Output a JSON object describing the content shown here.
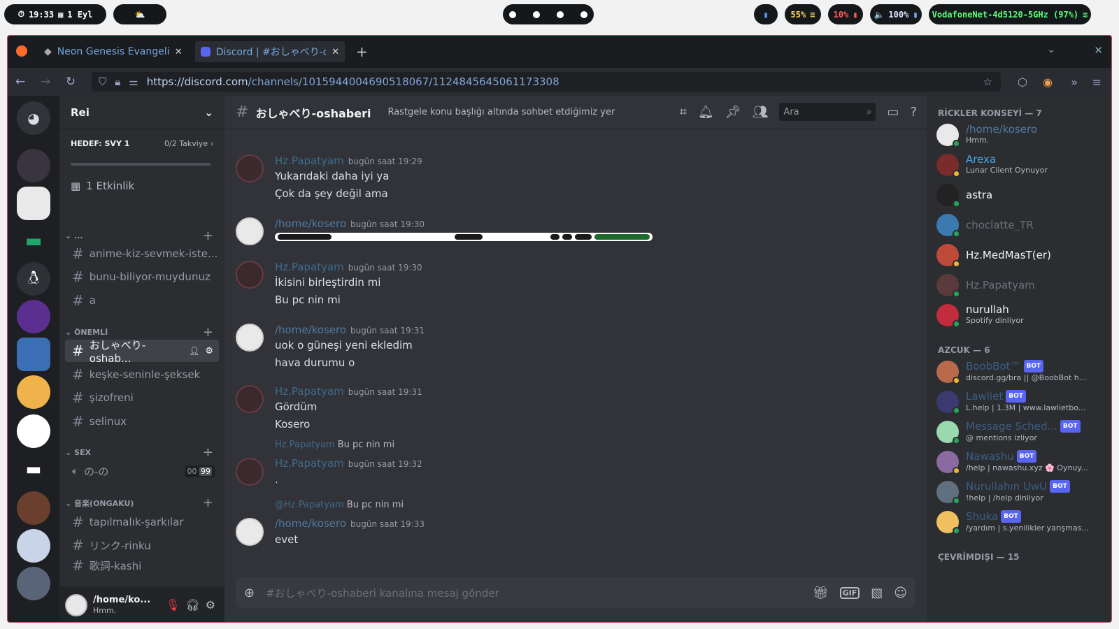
{
  "topbar": {
    "time": "19:33",
    "date": "1 Eyl",
    "brightness": "55%",
    "battery": "10%",
    "volume": "100%",
    "wifi": "VodafoneNet-4d5120-5GHz (97%)"
  },
  "browser": {
    "tabs": [
      {
        "label": "Neon Genesis Evangelion"
      },
      {
        "label": "Discord | #おしゃべり-os"
      }
    ],
    "url_domain": "https://discord.com",
    "url_path": "/channels/1015944004690518067/1124845645061173308"
  },
  "server": {
    "name": "Rei",
    "boost_goal": "HEDEF: SVY 1",
    "boost_count": "0/2 Takviye",
    "boost_progress": 0,
    "events": "1 Etkinlik",
    "categories": [
      {
        "name": "...",
        "channels": [
          "anime-kiz-sevmek-iste...",
          "bunu-biliyor-muydunuz",
          "a"
        ]
      },
      {
        "name": "ÖNEMLİ",
        "channels": [
          "おしゃべり-oshab...",
          "keşke-seninle-şeksek",
          "şizofreni",
          "selinux"
        ]
      },
      {
        "name": "SEX",
        "voice": "の-の",
        "voice_counts": [
          "00",
          "99"
        ]
      },
      {
        "name": "音楽(ONGAKU)",
        "channels": [
          "tapılmalık-şarkılar",
          "リンク-rinku",
          "歌詞-kashi"
        ]
      }
    ],
    "user": {
      "name": "/home/ko...",
      "status": "Hmm."
    }
  },
  "chat": {
    "channel": "おしゃべり-oshaberi",
    "topic": "Rastgele konu başlığı altında sohbet etdiğimiz yer",
    "search_placeholder": "Ara",
    "input_placeholder": "#おしゃべり-oshaberi kanalına mesaj gönder",
    "gif_label": "GIF",
    "messages": [
      {
        "author": "Hz.Papatyam",
        "time": "bugün saat 19:29",
        "lines": [
          "Yukarıdaki daha iyi ya",
          "Çok da şey değil ama"
        ]
      },
      {
        "author": "/home/kosero",
        "time": "bugün saat 19:30",
        "lines": []
      },
      {
        "author": "Hz.Papatyam",
        "time": "bugün saat 19:30",
        "lines": [
          "İkisini birleştirdin mi",
          "Bu pc nin mi"
        ]
      },
      {
        "author": "/home/kosero",
        "time": "bugün saat 19:31",
        "lines": [
          "uok o güneşi yeni ekledim",
          "hava durumu o"
        ]
      },
      {
        "author": "Hz.Papatyam",
        "time": "bugün saat 19:31",
        "lines": [
          "Gördüm",
          "Kosero"
        ]
      },
      {
        "author": "Hz.Papatyam",
        "time": "bugün saat 19:32",
        "lines": [
          "."
        ],
        "reply_to": "Hz.Papatyam",
        "reply_text": "Bu pc nin mi"
      },
      {
        "author": "/home/kosero",
        "time": "bugün saat 19:33",
        "lines": [
          "evet"
        ],
        "reply_to": "@Hz.Papatyam",
        "reply_text": "Bu pc nin mi"
      }
    ]
  },
  "members": {
    "groups": [
      {
        "name": "RİCKLER KONSEYİ — 7",
        "items": [
          {
            "name": "/home/kosero",
            "status": "Hmm.",
            "color": "#4e7aa3"
          },
          {
            "name": "Arexa",
            "status": "Lunar Client Oynuyor",
            "color": "#4aa6e8"
          },
          {
            "name": "astra",
            "status": "",
            "color": "#f2f3f5"
          },
          {
            "name": "choclatte_TR",
            "status": "",
            "color": "#6d6f78"
          },
          {
            "name": "Hz.MedMasT(er)",
            "status": "",
            "color": "#f2f3f5"
          },
          {
            "name": "Hz.Papatyam",
            "status": "",
            "color": "#6d6f78"
          },
          {
            "name": "nurullah",
            "status": "Spotify dinliyor",
            "color": "#f2f3f5"
          }
        ]
      },
      {
        "name": "AZCUK — 6",
        "items": [
          {
            "name": "BoobBot™",
            "status": "discord.gg/bra || @BoobBot h...",
            "color": "#3b5f85"
          },
          {
            "name": "Lawliet",
            "status": "L.help | 1.3M | www.lawlietbo...",
            "color": "#3b5f85"
          },
          {
            "name": "Message Sched...",
            "status": "@ mentions izliyor",
            "color": "#3b5f85"
          },
          {
            "name": "Nawashu",
            "status": "/help | nawashu.xyz 🌸 Oynuy...",
            "color": "#3b5f85"
          },
          {
            "name": "Nurullahın UwU",
            "status": "!help | /help dinliyor",
            "color": "#3b5f85"
          },
          {
            "name": "Shuka",
            "status": "/yardım | s.yenilikler yarışmas...",
            "color": "#3b5f85"
          }
        ]
      },
      {
        "name": "ÇEVRİMDIŞI — 15",
        "items": []
      }
    ],
    "bot_label": "BOT"
  }
}
